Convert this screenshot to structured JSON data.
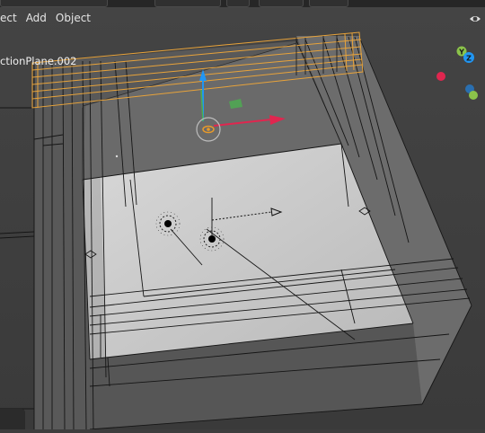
{
  "menu": {
    "items": [
      {
        "label": "ect"
      },
      {
        "label": "Add"
      },
      {
        "label": "Object"
      }
    ]
  },
  "viewport": {
    "active_object_label": "ctionPlane.002"
  },
  "gizmo": {
    "axes": [
      {
        "label": "Y",
        "color": "#8bc34a"
      },
      {
        "label": "Z",
        "color": "#2196f3"
      }
    ],
    "colors": {
      "x_neg": "#e0264f",
      "y_pos": "#8bc34a",
      "z_pos": "#2196f3"
    }
  },
  "colors": {
    "selection_outline": "#e8a33a",
    "wire": "#111111",
    "floor": "#c9c9c9",
    "walls": "#6e6e6e",
    "transform_x": "#e0264f",
    "transform_y": "#4caf50",
    "transform_z": "#2196f3"
  },
  "icons": [
    "eye-icon",
    "light-icon",
    "transform-gizmo-icon",
    "empty-marker-icon"
  ]
}
